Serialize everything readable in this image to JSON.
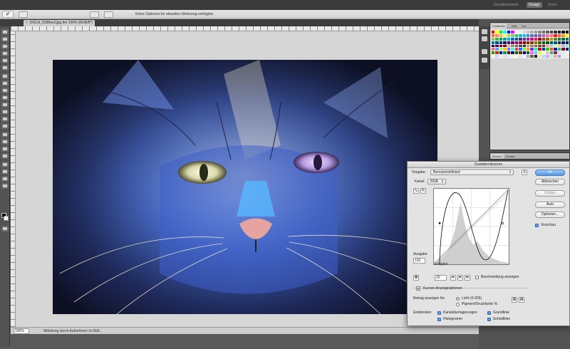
{
  "workspaces": {
    "essentials": "Grundelemente",
    "design": "Design",
    "paint": "Malen"
  },
  "options_bar": {
    "tool_icon": "eyedropper-icon",
    "message": "Keine Optionen für aktuelles Werkzeug verfügbar"
  },
  "document": {
    "tab_title": "DSCol_9186oeCjpg bei 100% (RGB/8*)",
    "close_glyph": "×"
  },
  "status": {
    "zoom": "100%",
    "text": "Mitteilung durch Aufnehmen im Bild..."
  },
  "panels": {
    "swatch_tabs": [
      "Farbfelder",
      "Stile",
      "Info"
    ],
    "panel2_tabs": [
      "Ebenen",
      "Kanäle"
    ]
  },
  "swatch_colors": [
    "#ff0000",
    "#ffff00",
    "#00ff00",
    "#00ffff",
    "#0000ff",
    "#ff00ff",
    "#ffffff",
    "#ebebeb",
    "#d6d6d6",
    "#c2c2c2",
    "#adadad",
    "#999999",
    "#858585",
    "#707070",
    "#5c5c5c",
    "#474747",
    "#333333",
    "#1f1f1f",
    "#0a0a0a",
    "#000000",
    "#f26c4f",
    "#f68e55",
    "#fbaf5c",
    "#fff467",
    "#acd372",
    "#7cc576",
    "#3bb878",
    "#1abbb4",
    "#00bff3",
    "#438ccb",
    "#5574b9",
    "#605ca8",
    "#855fa8",
    "#a763a8",
    "#f06ea9",
    "#f26d7d",
    "#ed1c24",
    "#f26522",
    "#f7941d",
    "#fff200",
    "#8dc63f",
    "#39b54a",
    "#00a651",
    "#00a99d",
    "#00aeef",
    "#0072bc",
    "#0054a6",
    "#2e3192",
    "#662d91",
    "#92278f",
    "#ec008c",
    "#ed145b",
    "#9e0b0f",
    "#a0410d",
    "#a36209",
    "#aba000",
    "#598527",
    "#1a7b30",
    "#007236",
    "#00746b",
    "#0076a3",
    "#004b80",
    "#003471",
    "#1b1464",
    "#440e62",
    "#630460",
    "#9e005d",
    "#9e0039",
    "#790000",
    "#7b2e00",
    "#7d4900",
    "#827b00",
    "#406618",
    "#005e20",
    "#005826",
    "#005952",
    "#005b7f",
    "#003663",
    "#002157",
    "#0d004c",
    "#32004b",
    "#4b0049",
    "#7b0046",
    "#7a0026",
    "#c7b299",
    "#998675",
    "#736357",
    "#534741",
    "#37302d",
    "#c69c6d",
    "#a67c52",
    "#8c6239",
    "#754c24",
    "#603913",
    "#ff9999",
    "#99ccff",
    "#ccff99",
    "#ffcc66",
    "#cc99ff",
    "#66ffcc",
    "#ff6666",
    "#6699ff",
    "#99ff66",
    "#ffcc00",
    "#9966ff",
    "#33ffcc",
    "#ff3333",
    "#3366ff",
    "#66ff33",
    "#ff9900",
    "#6633ff",
    "#00ffaa",
    "#cc0000",
    "#0033cc",
    "#33cc00",
    "#cc6600",
    "#3300cc",
    "#00cc88",
    "#990000",
    "#002299",
    "#229900",
    "#994400",
    "#220099",
    "#009966",
    "#660000",
    "#001166",
    "#116600",
    "#663300",
    "#110066",
    "#006644",
    "#ff66cc",
    "#66ccff",
    "#ccff66",
    "#ffff99",
    "#cccccc",
    "#888888",
    "#444444",
    "#ffccee",
    "#cceeff",
    "#eeffcc",
    "#fff0cc",
    "#e0ccff",
    "#ccfff0",
    "#ffd6d6",
    "#d6e4ff",
    "#e4ffd6",
    "#fff7d6",
    "#ecd6ff",
    "#d6fff4",
    "#b0b0b0",
    "#606060",
    "#202020",
    "#ffe0a0",
    "#a0e0ff",
    "#e0a0ff",
    "#a0ffe0",
    "#ffa0a0",
    "#a0a0ff"
  ],
  "curves": {
    "title": "Gradationskurven",
    "preset_label": "Vorgabe:",
    "preset_value": "Benutzerdefiniert",
    "channel_label": "Kanal:",
    "channel_value": "RGB",
    "output_label": "Ausgabe",
    "output_value": "132",
    "input_label": "Eingabe",
    "input_value": "20",
    "clipping_label": "Beschneidung anzeigen",
    "display_options": "Kurven-Anzeigeoptionen",
    "amount_label": "Betrag anzeigen für:",
    "light_label": "Licht (0-255)",
    "pigment_label": "Pigment/Druckfarbe %",
    "show_label": "Einblenden:",
    "channel_overlays": "Kanalüberlagerungen",
    "baseline": "Grundlinie",
    "histogram": "Histogramm",
    "intersection": "Schnittlinie",
    "buttons": {
      "ok": "OK",
      "cancel": "Abbrechen",
      "smooth": "Glätten",
      "auto": "Auto",
      "options": "Optionen..."
    },
    "preview_label": "Vorschau"
  }
}
